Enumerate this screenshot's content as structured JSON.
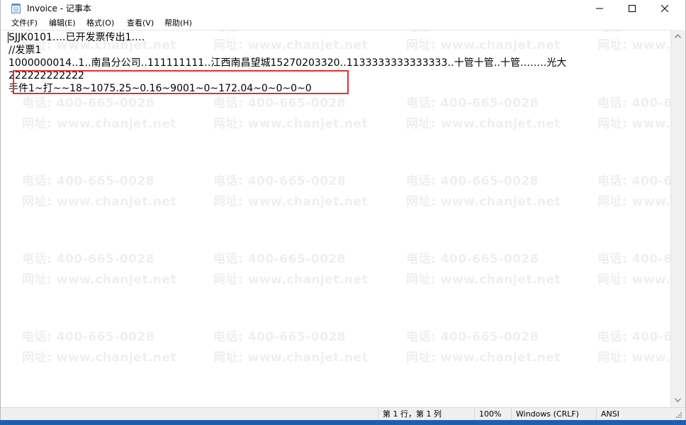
{
  "window": {
    "title": "Invoice - 记事本"
  },
  "menu": {
    "file": "文件(F)",
    "edit": "编辑(E)",
    "format": "格式(O)",
    "view": "查看(V)",
    "help": "帮助(H)"
  },
  "editor": {
    "lines": [
      "SJJK0101‥‥已开发票传出1‥‥",
      "//发票1",
      "1000000014‥1‥南昌分公司‥111111111‥江西南昌望城15270203320‥1133333333333333‥十管十管‥十管‥‥‥‥光大",
      "222222222222",
      "手件1~打~~18~1075.25~0.16~9001~0~172.04~0~0~0~0"
    ]
  },
  "watermark": {
    "phone": "电话: 400-665-0028",
    "site": "网址: www.chanjet.net"
  },
  "status": {
    "position": "第 1 行，第 1 列",
    "zoom": "100%",
    "line_ending": "Windows (CRLF)",
    "encoding": "ANSI"
  },
  "colors": {
    "highlight": "#e0322f",
    "taskbar": "#1e5db3"
  }
}
